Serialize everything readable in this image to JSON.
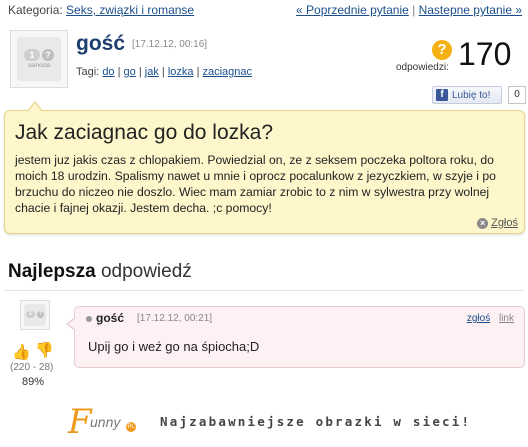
{
  "topbar": {
    "category_label": "Kategoria:",
    "category_link": "Seks, związki i romanse",
    "prev_label": "« Poprzednie pytanie",
    "separator": "|",
    "next_label": "Nastepne pytanie »"
  },
  "question": {
    "avatar_brand": "samosia",
    "author": "gość",
    "date": "[17.12.12, 00:16]",
    "tags_label": "Tagi:",
    "tags": [
      "do",
      "go",
      "jak",
      "lozka",
      "zaciagnac"
    ],
    "tag_separator": "|",
    "answers_icon": "?",
    "answers_label": "odpowiedzi:",
    "answers_count": "170",
    "like_label": "Lubię to!",
    "like_count": "0",
    "title": "Jak zaciagnac go do lozka?",
    "body": "jestem juz jakis czas z chlopakiem. Powiedzial on, ze z seksem poczeka poltora roku, do moich 18 urodzin. Spalismy nawet u mnie i oprocz pocalunkow z jezyczkiem, w szyje i po brzuchu do niczeo nie doszlo. Wiec mam zamiar zrobic to z nim w sylwestra przy wolnej chacie i fajnej okazji. Jestem decha. ;c pomocy!",
    "report_label": "Zgłoś"
  },
  "best_answer": {
    "heading_bold": "Najlepsza",
    "heading_light": "odpowiedź",
    "avatar_brand": "samosia",
    "author": "gość",
    "date": "[17.12.12, 00:21]",
    "report_label": "zgłoś",
    "link_label": "link",
    "body": "Upij go i weź go na śpiocha;D",
    "votes": "(220 - 28)",
    "percent": "89%"
  },
  "footer": {
    "logo_f": "F",
    "logo_rest": "unny",
    "logo_dot": "PL",
    "tagline": "Najzabawniejsze obrazki w sieci!"
  },
  "icons": {
    "answers": "question-badge-icon",
    "facebook": "facebook-icon",
    "report": "close-circle-icon",
    "vote_up": "thumbs-up-icon",
    "vote_down": "thumbs-down-icon",
    "dot": "bullet-icon"
  },
  "colors": {
    "link": "#1a4f8b",
    "question_bg": "#fef7cc",
    "answer_bg": "#fdf1f3",
    "accent_orange": "#f09a1e",
    "author": "#1c3e6e"
  }
}
